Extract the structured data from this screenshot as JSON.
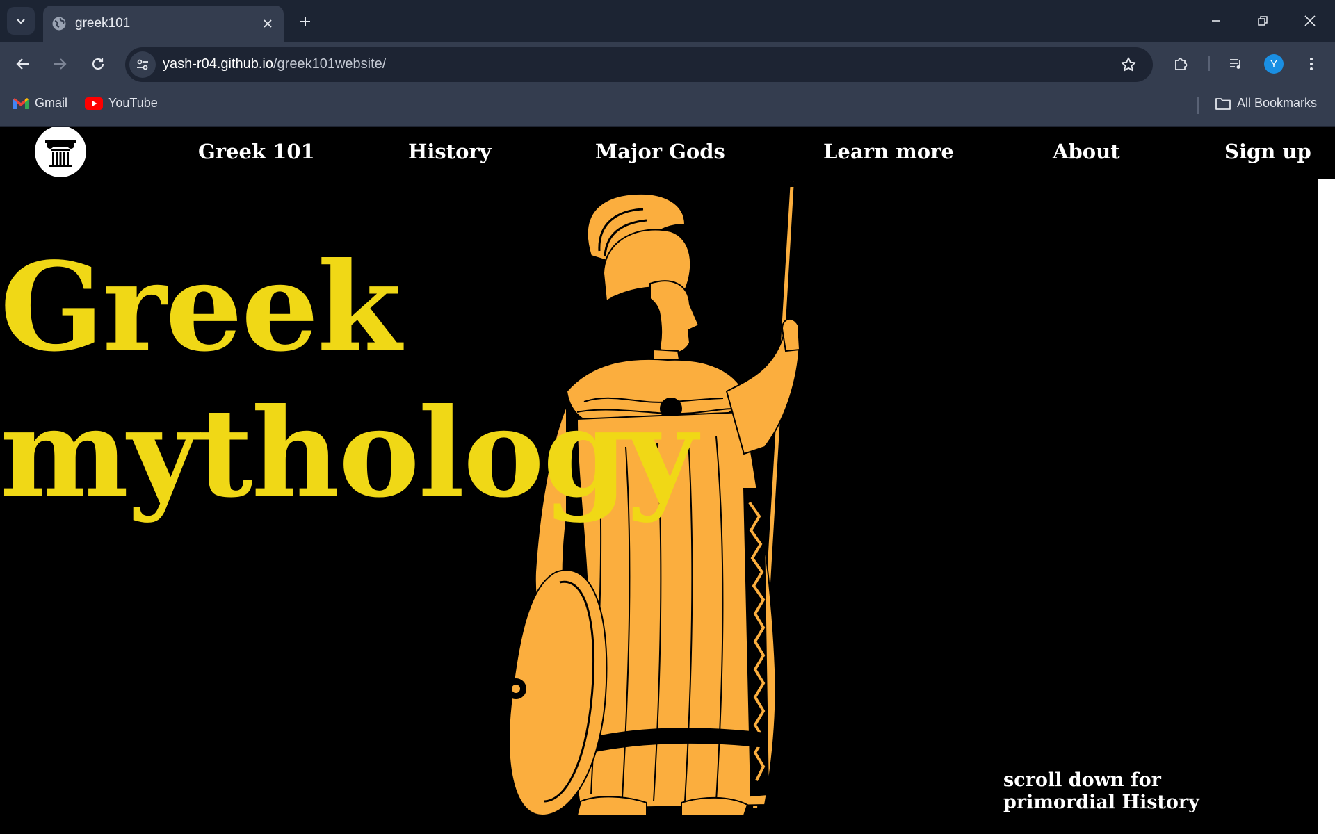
{
  "browser": {
    "tab": {
      "title": "greek101"
    },
    "url": {
      "host": "yash-r04.github.io",
      "path": "/greek101website/"
    },
    "profile_initial": "Y",
    "bookmarks": [
      {
        "label": "Gmail",
        "icon": "gmail-icon"
      },
      {
        "label": "YouTube",
        "icon": "youtube-icon"
      }
    ],
    "all_bookmarks_label": "All Bookmarks"
  },
  "site": {
    "logo_icon": "greek-column-icon",
    "nav": [
      "Greek 101",
      "History",
      "Major Gods",
      "Learn more",
      "About",
      "Sign up"
    ],
    "hero": {
      "line1": "Greek",
      "line2": "mythology"
    },
    "scroll_hint": {
      "line1": "scroll down for",
      "line2": "primordial History"
    },
    "illustration_icon": "athena-illustration"
  },
  "colors": {
    "hero_text": "#f0d816",
    "illustration": "#fbae3e",
    "background": "#000000",
    "chrome_dark": "#1c2433",
    "chrome_mid": "#343d4f"
  }
}
